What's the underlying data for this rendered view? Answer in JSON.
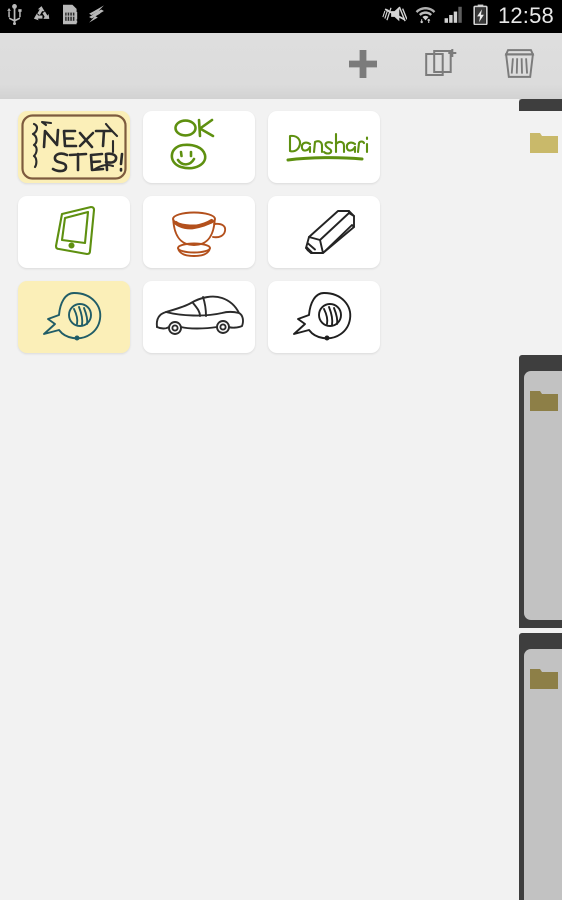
{
  "status_bar": {
    "icons": [
      "usb-icon",
      "sync-icon",
      "sim-card-alert-icon",
      "data-transfer-icon"
    ],
    "right_icons": [
      "vibrate-mute-icon",
      "wifi-icon",
      "cellular-signal-icon",
      "battery-charging-icon"
    ],
    "clock": "12:58",
    "background": "#000000",
    "text_color": "#e8e8e8"
  },
  "action_bar": {
    "background": "#dcdcdc",
    "icon_color": "#7b7b7b",
    "buttons": [
      {
        "name": "add-note-button",
        "icon": "plus-icon",
        "label": "Add"
      },
      {
        "name": "duplicate-note-button",
        "icon": "copy-add-icon",
        "label": "Duplicate"
      },
      {
        "name": "delete-note-button",
        "icon": "trash-icon",
        "label": "Delete"
      }
    ]
  },
  "canvas": {
    "background": "#f2f2f2"
  },
  "notes": {
    "selected_index": 0,
    "items": [
      {
        "name": "note-card-next-step",
        "thumb": "handwriting-next-step",
        "text": "NEXT STEP !",
        "ink": "#2b2b2b",
        "bg": "#fbefb8",
        "selected": true,
        "frame": "#7d5b3e"
      },
      {
        "name": "note-card-ok-smiley",
        "thumb": "handwriting-ok-smiley",
        "text": "OK",
        "ink": "#5e9010",
        "bg": "#ffffff",
        "selected": false,
        "frame": ""
      },
      {
        "name": "note-card-danshari",
        "thumb": "handwriting-danshari",
        "text": "Danshari",
        "ink": "#5e9010",
        "bg": "#ffffff",
        "selected": false,
        "frame": ""
      },
      {
        "name": "note-card-smartphone",
        "thumb": "sketch-smartphone",
        "text": "",
        "ink": "#5e9010",
        "bg": "#ffffff",
        "selected": false,
        "frame": ""
      },
      {
        "name": "note-card-coffee-cup",
        "thumb": "sketch-coffee-cup",
        "text": "",
        "ink": "#b3501c",
        "bg": "#ffffff",
        "selected": false,
        "frame": ""
      },
      {
        "name": "note-card-pencil",
        "thumb": "sketch-pencil",
        "text": "",
        "ink": "#242424",
        "bg": "#ffffff",
        "selected": false,
        "frame": ""
      },
      {
        "name": "note-card-speech-teal",
        "thumb": "sketch-speech-bubble",
        "text": "",
        "ink": "#215d67",
        "bg": "#fbefb8",
        "selected": false,
        "frame": ""
      },
      {
        "name": "note-card-car",
        "thumb": "sketch-car",
        "text": "",
        "ink": "#2b2b2b",
        "bg": "#ffffff",
        "selected": false,
        "frame": ""
      },
      {
        "name": "note-card-speech-dark",
        "thumb": "sketch-speech-bubble",
        "text": "",
        "ink": "#1f1f1f",
        "bg": "#ffffff",
        "selected": false,
        "frame": ""
      }
    ]
  },
  "drawers": {
    "folder_color_light": "#c9b96a",
    "folder_color_dark": "#8d7f47",
    "edge_color": "#3e3e3e",
    "panel_color": "#c2c2c2",
    "items": [
      {
        "name": "drawer-tab-1",
        "icon": "folder-icon",
        "state": "open"
      },
      {
        "name": "drawer-tab-2",
        "icon": "folder-icon",
        "state": "closed"
      },
      {
        "name": "drawer-tab-3",
        "icon": "folder-icon",
        "state": "closed"
      }
    ]
  }
}
